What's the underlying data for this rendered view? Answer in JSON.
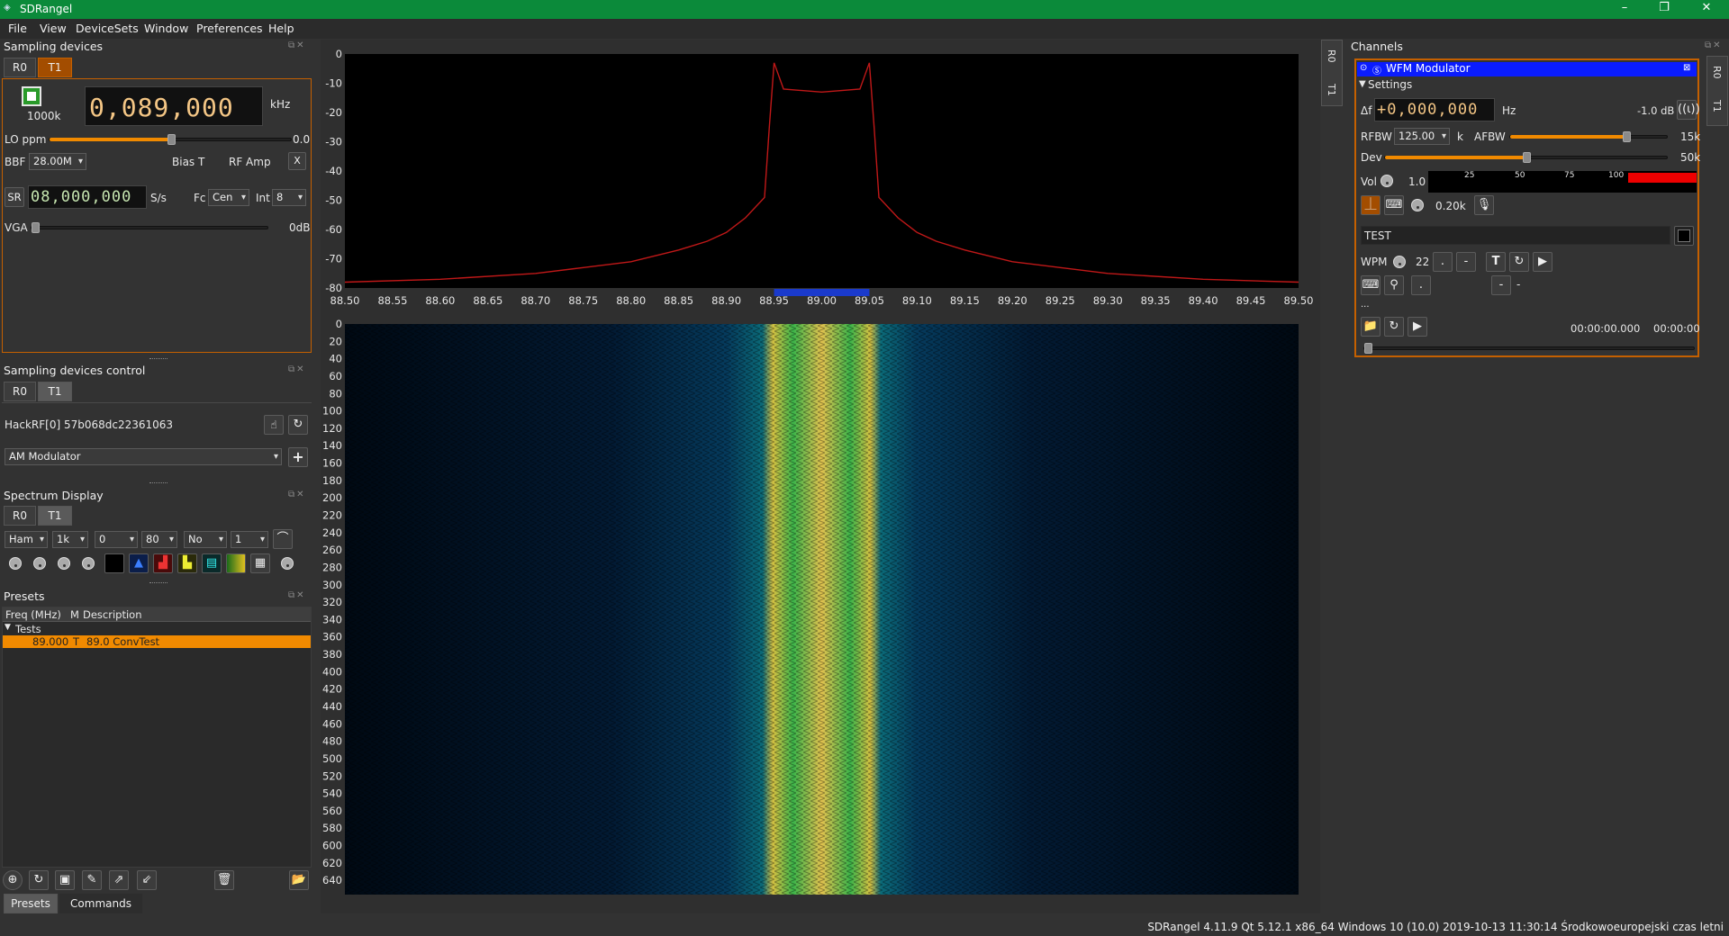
{
  "window": {
    "title": "SDRangel",
    "minimize": "–",
    "restore": "❐",
    "close": "✕"
  },
  "menu": [
    "File",
    "View",
    "DeviceSets",
    "Window",
    "Preferences",
    "Help"
  ],
  "sampling_devices": {
    "title": "Sampling devices",
    "tabs": [
      "R0",
      "T1"
    ],
    "sample_rate_label": "1000k",
    "center_freq": "0,089,000",
    "freq_unit": "kHz",
    "lo_ppm_label": "LO ppm",
    "lo_ppm_value": "0.0",
    "bbf_label": "BBF",
    "bbf_value": "28.00M",
    "bias_t": "Bias T",
    "rf_amp": "RF Amp",
    "x_button": "X",
    "sr_label": "SR",
    "sr_value": "08,000,000",
    "sr_unit": "S/s",
    "fc_label": "Fc",
    "fc_value": "Cen",
    "int_label": "Int",
    "int_value": "8",
    "vga_label": "VGA",
    "vga_value": "0dB",
    "lo_ppm_fraction": 0.5,
    "vga_fraction": 0.0
  },
  "sampling_devices_control": {
    "title": "Sampling devices control",
    "tabs": [
      "R0",
      "T1"
    ],
    "device": "HackRF[0] 57b068dc22361063",
    "channel_combo": "AM Modulator",
    "add": "+"
  },
  "spectrum_display": {
    "title": "Spectrum Display",
    "tabs": [
      "R0",
      "T1"
    ],
    "combos": [
      "Ham",
      "1k",
      "0",
      "80",
      "No",
      "1"
    ]
  },
  "presets": {
    "title": "Presets",
    "col_freq": "Freq (MHz)",
    "col_mode": "M",
    "col_desc": "Description",
    "group": "Tests",
    "row": {
      "freq": "89.000",
      "mode": "T",
      "desc": "89.0 ConvTest"
    },
    "bottom_tabs": [
      "Presets",
      "Commands"
    ]
  },
  "spectrum": {
    "y_ticks": [
      "0",
      "-10",
      "-20",
      "-30",
      "-40",
      "-50",
      "-60",
      "-70",
      "-80"
    ],
    "x_ticks": [
      "88.50",
      "88.55",
      "88.60",
      "88.65",
      "88.70",
      "88.75",
      "88.80",
      "88.85",
      "88.90",
      "88.95",
      "89.00",
      "89.05",
      "89.10",
      "89.15",
      "89.20",
      "89.25",
      "89.30",
      "89.35",
      "89.40",
      "89.45",
      "89.50"
    ],
    "waterfall_ticks": [
      "0",
      "20",
      "40",
      "60",
      "80",
      "100",
      "120",
      "140",
      "160",
      "180",
      "200",
      "220",
      "240",
      "260",
      "280",
      "300",
      "320",
      "340",
      "360",
      "380",
      "400",
      "420",
      "440",
      "460",
      "480",
      "500",
      "520",
      "540",
      "560",
      "580",
      "600",
      "620",
      "640"
    ],
    "side_tabs": [
      "R0",
      "T1"
    ],
    "trace_color": "#c01818"
  },
  "chart_data": {
    "type": "line",
    "title": "",
    "xlabel": "",
    "ylabel": "",
    "xlim": [
      88.5,
      89.5
    ],
    "ylim": [
      -80,
      0
    ],
    "series": [
      {
        "x": [
          88.5,
          88.6,
          88.7,
          88.75,
          88.8,
          88.85,
          88.88,
          88.9,
          88.92,
          88.94,
          88.945,
          88.95,
          88.96,
          89.0,
          89.04,
          89.05,
          89.055,
          89.06,
          89.08,
          89.1,
          89.12,
          89.15,
          89.2,
          89.25,
          89.3,
          89.4,
          89.5
        ],
        "y": [
          -78,
          -77,
          -75,
          -73,
          -71,
          -67,
          -64,
          -61,
          -56,
          -49,
          -25,
          -3,
          -12,
          -13,
          -12,
          -3,
          -25,
          -49,
          -56,
          -61,
          -64,
          -67,
          -71,
          -73,
          -75,
          -77,
          -78
        ]
      }
    ]
  },
  "channels": {
    "title": "Channels",
    "side_tabs": [
      "R0",
      "T1"
    ],
    "plugin_title": "WFM Modulator",
    "settings": "Settings",
    "df_label": "Δf",
    "df_value": "+0,000,000",
    "df_unit": "Hz",
    "power": "-1.0 dB",
    "rfbw_label": "RFBW",
    "rfbw_value": "125.00",
    "rfbw_unit": "k",
    "afbw_label": "AFBW",
    "afbw_value": "15k",
    "afbw_fraction": 0.75,
    "dev_label": "Dev",
    "dev_value": "50k",
    "dev_fraction": 0.5,
    "vol_label": "Vol",
    "vol_value": "1.0",
    "vu_ticks": [
      "25",
      "50",
      "75",
      "100"
    ],
    "tone_value": "0.20k",
    "cw_text": "TEST",
    "wpm_label": "WPM",
    "wpm_value": "22",
    "dot": ".",
    "dash": "-",
    "t_btn": "T",
    "dot2": ".",
    "dash2": "-",
    "dash3": "-",
    "ellipsis": "...",
    "time1": "00:00:00.000",
    "time2": "00:00:00"
  },
  "status": "SDRangel 4.11.9 Qt 5.12.1 x86_64 Windows 10 (10.0)  2019-10-13 11:30:14 Środkowoeuropejski czas letni"
}
